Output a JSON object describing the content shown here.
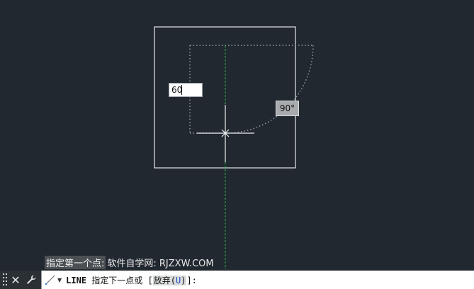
{
  "canvas": {
    "background": "#212830",
    "dynamic_input_value": "60",
    "angle_tooltip": "90°",
    "colors": {
      "frame": "#e6e6e6",
      "tracking": "#2db34a",
      "arc": "#9aa0a6",
      "crosshair": "#f0f0f0"
    }
  },
  "history": {
    "prompt": "指定第一个点:",
    "watermark": "软件自学网: RJZXW.COM"
  },
  "command_line": {
    "close_icon": "close-icon",
    "customize_icon": "wrench-icon",
    "recent_icon": "line-command-icon",
    "command_name": "LINE",
    "prompt_text": " 指定下一点或 [",
    "option_label": "放弃(",
    "option_key": "U",
    "option_close": ")",
    "prompt_end": "]:"
  }
}
